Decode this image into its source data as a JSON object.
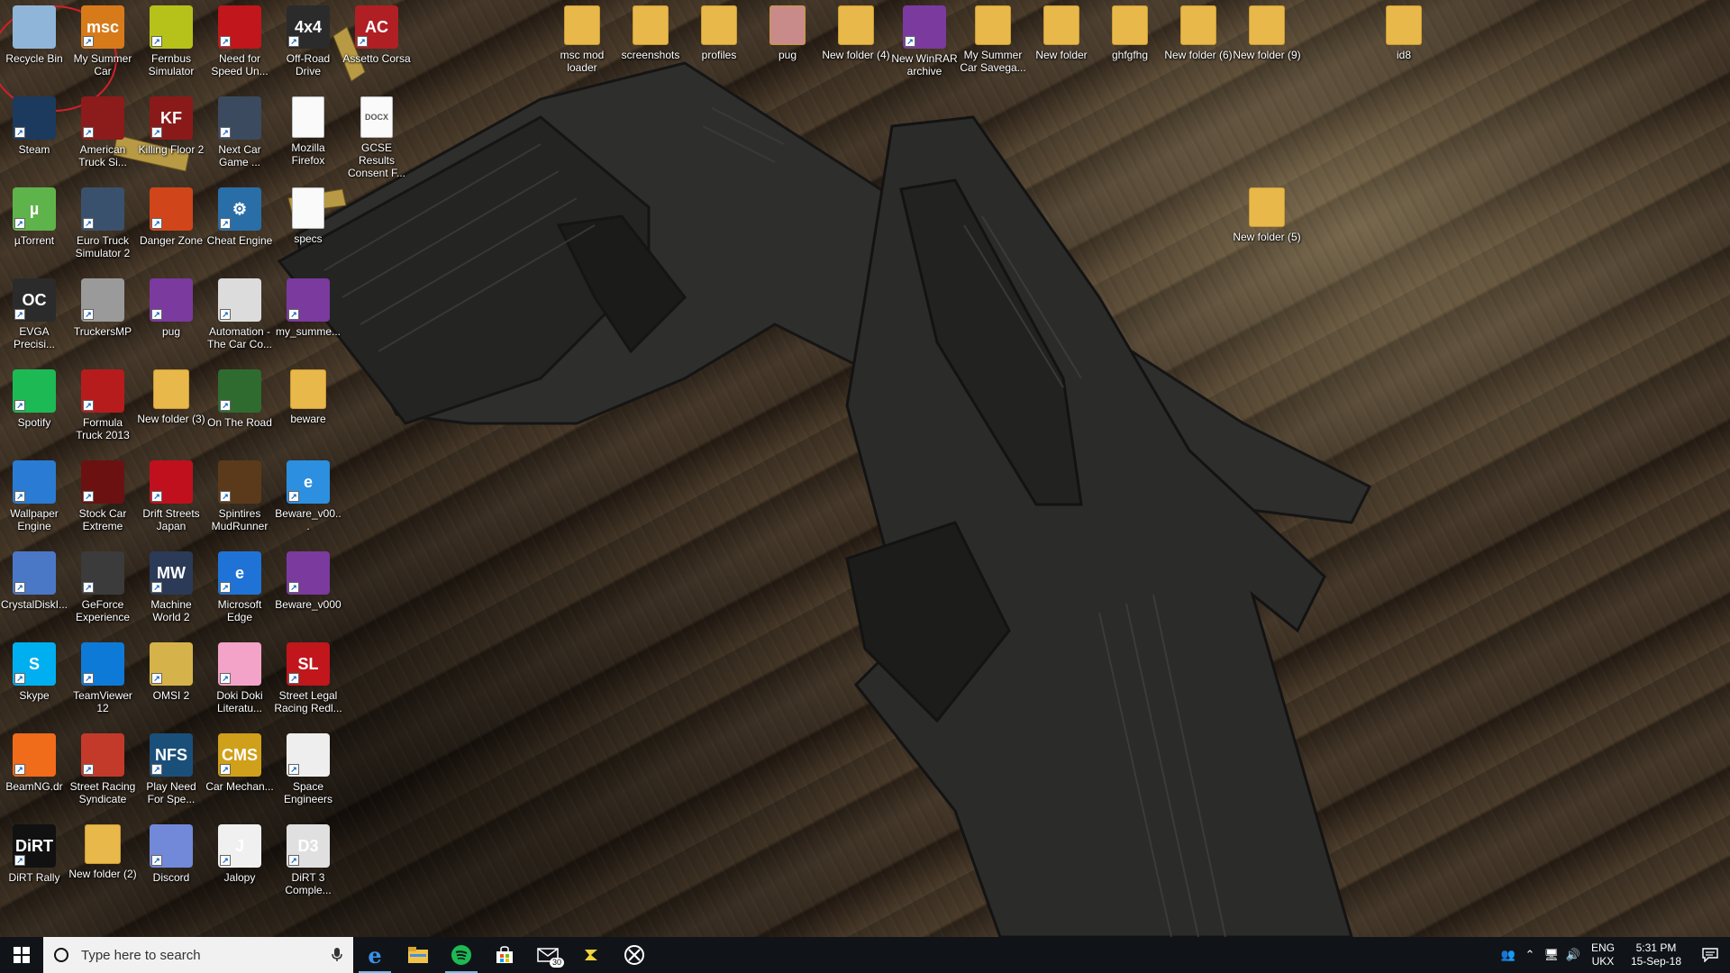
{
  "desktop_icons": [
    {
      "label": "Recycle Bin",
      "icon": "recycle-bin-icon",
      "color": "#8fb6d8",
      "glyph": ""
    },
    {
      "label": "My Summer Car",
      "icon": "msc-icon",
      "color": "#d77a1a",
      "glyph": "msc"
    },
    {
      "label": "Fernbus Simulator",
      "icon": "bus-icon",
      "color": "#b6c21a",
      "glyph": ""
    },
    {
      "label": "Need for Speed Un...",
      "icon": "nfs-icon",
      "color": "#c0161c",
      "glyph": ""
    },
    {
      "label": "Off-Road Drive",
      "icon": "offroad-icon",
      "color": "#2b2b2b",
      "glyph": "4x4"
    },
    {
      "label": "Assetto Corsa",
      "icon": "assetto-icon",
      "color": "#b01f24",
      "glyph": "AC"
    },
    {
      "label": "Steam",
      "icon": "steam-icon",
      "color": "#1b3a5e",
      "glyph": ""
    },
    {
      "label": "American Truck Si...",
      "icon": "ats-icon",
      "color": "#8c1b1b",
      "glyph": ""
    },
    {
      "label": "Killing Floor 2",
      "icon": "kf2-icon",
      "color": "#8a1a1a",
      "glyph": "KF"
    },
    {
      "label": "Next Car Game ...",
      "icon": "next-car-icon",
      "color": "#3b4a5e",
      "glyph": ""
    },
    {
      "label": "Mozilla Firefox",
      "icon": "document-icon",
      "color": "#ffffff",
      "glyph": ""
    },
    {
      "label": "GCSE Results Consent F...",
      "icon": "docx-icon",
      "color": "#ffffff",
      "glyph": "DOCX"
    },
    {
      "label": "µTorrent",
      "icon": "utorrent-icon",
      "color": "#5fb34b",
      "glyph": "µ"
    },
    {
      "label": "Euro Truck Simulator 2",
      "icon": "ets2-icon",
      "color": "#39516d",
      "glyph": ""
    },
    {
      "label": "Danger Zone",
      "icon": "danger-zone-icon",
      "color": "#d0451a",
      "glyph": ""
    },
    {
      "label": "Cheat Engine",
      "icon": "cheat-engine-icon",
      "color": "#2a6ea8",
      "glyph": "⚙"
    },
    {
      "label": "specs",
      "icon": "document-icon",
      "color": "#ffffff",
      "glyph": ""
    },
    {
      "label": "EVGA Precisi...",
      "icon": "evga-icon",
      "color": "#2b2b2b",
      "glyph": "OC"
    },
    {
      "label": "TruckersMP",
      "icon": "truckersmp-icon",
      "color": "#9a9a9a",
      "glyph": ""
    },
    {
      "label": "pug",
      "icon": "winrar-icon",
      "color": "#7b3a9e",
      "glyph": ""
    },
    {
      "label": "Automation - The Car Co...",
      "icon": "automation-icon",
      "color": "#dcdcdc",
      "glyph": ""
    },
    {
      "label": "my_summe...",
      "icon": "winrar-icon",
      "color": "#7b3a9e",
      "glyph": ""
    },
    {
      "label": "Spotify",
      "icon": "spotify-icon",
      "color": "#1db954",
      "glyph": ""
    },
    {
      "label": "Formula Truck 2013",
      "icon": "formula-truck-icon",
      "color": "#b61c1c",
      "glyph": ""
    },
    {
      "label": "New folder (3)",
      "icon": "folder-icon",
      "color": "#e8b84a",
      "glyph": ""
    },
    {
      "label": "On The Road",
      "icon": "on-the-road-icon",
      "color": "#2f6b2f",
      "glyph": ""
    },
    {
      "label": "beware",
      "icon": "folder-icon",
      "color": "#e8b84a",
      "glyph": ""
    },
    {
      "label": "Wallpaper Engine",
      "icon": "wallpaper-engine-icon",
      "color": "#2a7bd3",
      "glyph": ""
    },
    {
      "label": "Stock Car Extreme",
      "icon": "stock-car-icon",
      "color": "#6b1111",
      "glyph": ""
    },
    {
      "label": "Drift Streets Japan",
      "icon": "drift-icon",
      "color": "#c0101e",
      "glyph": ""
    },
    {
      "label": "Spintires MudRunner",
      "icon": "mudrunner-icon",
      "color": "#5a3a1a",
      "glyph": ""
    },
    {
      "label": "Beware_v00...",
      "icon": "ie-icon",
      "color": "#2c8fe0",
      "glyph": "e"
    },
    {
      "label": "CrystalDiskI...",
      "icon": "crystaldisk-icon",
      "color": "#4a78c7",
      "glyph": ""
    },
    {
      "label": "GeForce Experience",
      "icon": "geforce-icon",
      "color": "#3b3b3b",
      "glyph": ""
    },
    {
      "label": "Machine World 2",
      "icon": "machine-world-icon",
      "color": "#2b3a56",
      "glyph": "MW"
    },
    {
      "label": "Microsoft Edge",
      "icon": "edge-icon",
      "color": "#1f73d6",
      "glyph": "e"
    },
    {
      "label": "Beware_v000",
      "icon": "winrar-icon",
      "color": "#7b3a9e",
      "glyph": ""
    },
    {
      "label": "Skype",
      "icon": "skype-icon",
      "color": "#00aff0",
      "glyph": "S"
    },
    {
      "label": "TeamViewer 12",
      "icon": "teamviewer-icon",
      "color": "#0e7ad8",
      "glyph": ""
    },
    {
      "label": "OMSI 2",
      "icon": "omsi-icon",
      "color": "#d6b34a",
      "glyph": ""
    },
    {
      "label": "Doki Doki Literatu...",
      "icon": "ddlc-icon",
      "color": "#f3a3c7",
      "glyph": ""
    },
    {
      "label": "Street Legal Racing Redl...",
      "icon": "slrr-icon",
      "color": "#c0161c",
      "glyph": "SL"
    },
    {
      "label": "BeamNG.dr",
      "icon": "beamng-icon",
      "color": "#f06b1a",
      "glyph": ""
    },
    {
      "label": "Street Racing Syndicate",
      "icon": "srs-icon",
      "color": "#c33a2b",
      "glyph": ""
    },
    {
      "label": "Play Need For Spe...",
      "icon": "nfs-play-icon",
      "color": "#1a4f7a",
      "glyph": "NFS"
    },
    {
      "label": "Car Mechan...",
      "icon": "cms-icon",
      "color": "#d0a01a",
      "glyph": "CMS"
    },
    {
      "label": "Space Engineers",
      "icon": "space-engineers-icon",
      "color": "#eeeeee",
      "glyph": ""
    },
    {
      "label": "DiRT Rally",
      "icon": "dirt-rally-icon",
      "color": "#111111",
      "glyph": "DiRT"
    },
    {
      "label": "New folder (2)",
      "icon": "folder-icon",
      "color": "#e8b84a",
      "glyph": ""
    },
    {
      "label": "Discord",
      "icon": "discord-icon",
      "color": "#7289da",
      "glyph": ""
    },
    {
      "label": "Jalopy",
      "icon": "jalopy-icon",
      "color": "#f0f0f0",
      "glyph": "J"
    },
    {
      "label": "DiRT 3 Comple...",
      "icon": "dirt3-icon",
      "color": "#e0e0e0",
      "glyph": "D3"
    },
    {
      "label": "msc mod loader",
      "icon": "folder-icon",
      "color": "#e8b84a",
      "glyph": ""
    },
    {
      "label": "screenshots",
      "icon": "folder-icon",
      "color": "#e8b84a",
      "glyph": ""
    },
    {
      "label": "profiles",
      "icon": "folder-icon",
      "color": "#e8b84a",
      "glyph": ""
    },
    {
      "label": "pug",
      "icon": "folder-icon",
      "color": "#c98a8a",
      "glyph": ""
    },
    {
      "label": "New folder (4)",
      "icon": "folder-icon",
      "color": "#e8b84a",
      "glyph": ""
    },
    {
      "label": "New WinRAR archive",
      "icon": "winrar-icon",
      "color": "#7b3a9e",
      "glyph": ""
    },
    {
      "label": "My Summer Car Savega...",
      "icon": "folder-icon",
      "color": "#e8b84a",
      "glyph": ""
    },
    {
      "label": "New folder",
      "icon": "folder-icon",
      "color": "#e8b84a",
      "glyph": ""
    },
    {
      "label": "ghfgfhg",
      "icon": "folder-icon",
      "color": "#e8b84a",
      "glyph": ""
    },
    {
      "label": "New folder (6)",
      "icon": "folder-icon",
      "color": "#e8b84a",
      "glyph": ""
    },
    {
      "label": "New folder (9)",
      "icon": "folder-icon",
      "color": "#e8b84a",
      "glyph": ""
    },
    {
      "label": "id8",
      "icon": "folder-icon",
      "color": "#e8b84a",
      "glyph": ""
    },
    {
      "label": "New folder (5)",
      "icon": "folder-icon",
      "color": "#e8b84a",
      "glyph": ""
    }
  ],
  "taskbar": {
    "search_placeholder": "Type here to search",
    "mail_badge": "30",
    "lang_line1": "ENG",
    "lang_line2": "UKX",
    "time": "5:31 PM",
    "date": "15-Sep-18",
    "colors": {
      "background": "#101418",
      "accent": "#76b9ed"
    }
  }
}
